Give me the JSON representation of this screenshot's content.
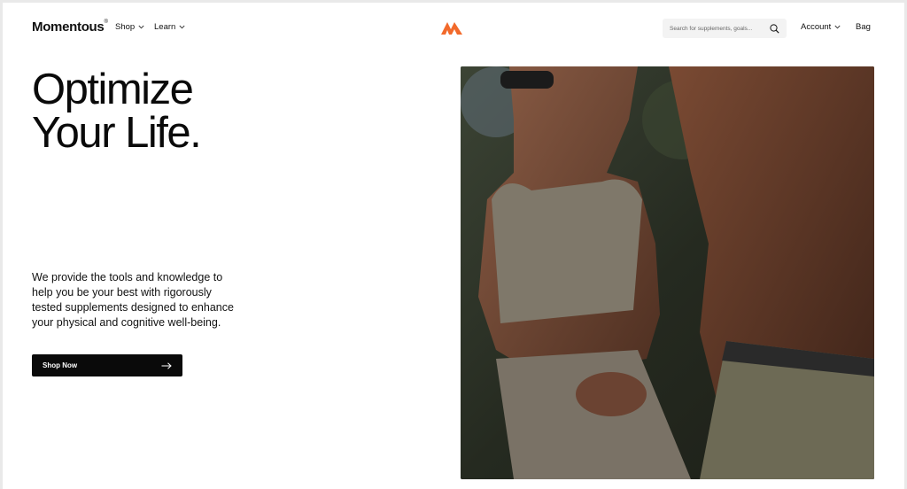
{
  "header": {
    "logo": "Momentous",
    "logo_mark": "®",
    "nav": [
      {
        "label": "Shop"
      },
      {
        "label": "Learn"
      }
    ],
    "search_placeholder": "Search for supplements, goals...",
    "account_label": "Account",
    "bag_label": "Bag"
  },
  "hero": {
    "headline_line1": "Optimize",
    "headline_line2": "Your Life.",
    "description": "We provide the tools and knowledge to help you be your best with rigorously tested supplements designed to enhance your physical and cognitive well-being.",
    "cta_label": "Shop Now"
  },
  "colors": {
    "brand_accent": "#f26a2b",
    "button_bg": "#0a0a0a",
    "search_bg": "#f3f3f3"
  },
  "icons": [
    "momentous-m-icon",
    "chevron-down-icon",
    "search-icon",
    "arrow-right-icon"
  ]
}
